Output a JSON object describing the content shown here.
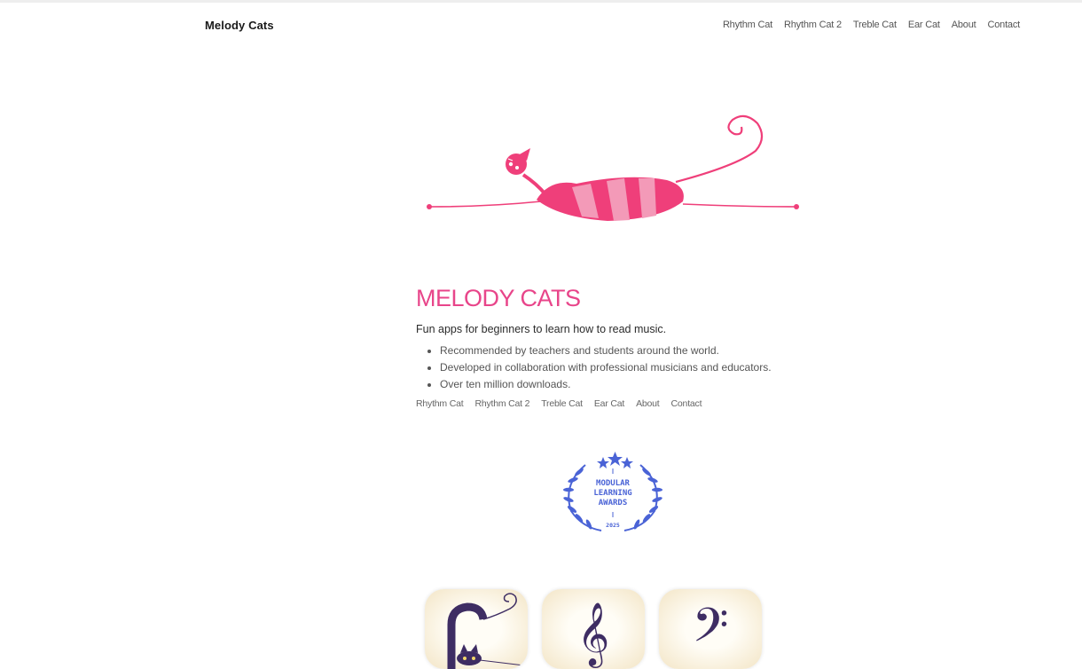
{
  "header": {
    "brand": "Melody Cats",
    "nav": [
      "Rhythm Cat",
      "Rhythm Cat 2",
      "Treble Cat",
      "Ear Cat",
      "About",
      "Contact"
    ]
  },
  "main": {
    "title": "MELODY CATS",
    "tagline": "Fun apps for beginners to learn how to read music.",
    "features": [
      "Recommended by teachers and students around the world.",
      "Developed in collaboration with professional musicians and educators.",
      "Over ten million downloads."
    ],
    "footer_nav": [
      "Rhythm Cat",
      "Rhythm Cat 2",
      "Treble Cat",
      "Ear Cat",
      "About",
      "Contact"
    ]
  },
  "award": {
    "line1": "MODULAR",
    "line2": "LEARNING",
    "line3": "AWARDS",
    "year": "2025"
  },
  "app_icons": [
    {
      "icon": "rhythm-cat-app-icon"
    },
    {
      "icon": "treble-clef-icon"
    },
    {
      "icon": "bass-clef-icon"
    }
  ],
  "colors": {
    "accent_pink": "#e8458a",
    "cat_pink": "#ef3f7a",
    "cat_light_pink": "#f39ab8",
    "award_blue": "#4a63d6",
    "icon_purple": "#3e2d63"
  }
}
